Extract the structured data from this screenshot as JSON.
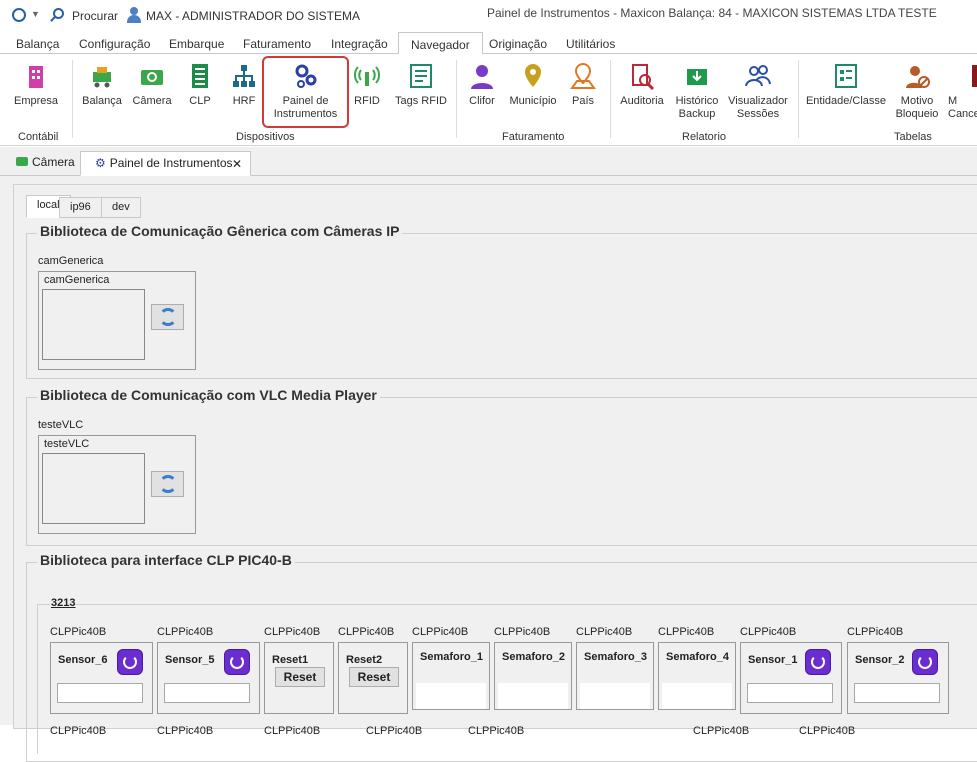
{
  "titlebar": {
    "search_label": "Procurar",
    "user_label": "MAX - ADMINISTRADOR DO SISTEMA",
    "window_title": "Painel de Instrumentos - Maxicon Balança: 84 - MAXICON SISTEMAS LTDA TESTE"
  },
  "ribbon_tabs": [
    "Balança",
    "Configuração",
    "Embarque",
    "Faturamento",
    "Integração",
    "Navegador",
    "Originação",
    "Utilitários"
  ],
  "ribbon": {
    "buttons": [
      {
        "label": "Empresa",
        "icon": "building-icon"
      },
      {
        "label": "Balança",
        "icon": "scale-cart-icon"
      },
      {
        "label": "Câmera",
        "icon": "camera-icon"
      },
      {
        "label": "CLP",
        "icon": "clp-icon"
      },
      {
        "label": "HRF",
        "icon": "network-tree-icon"
      },
      {
        "label": "Painel de Instrumentos",
        "icon": "gears-icon"
      },
      {
        "label": "RFID",
        "icon": "rfid-icon"
      },
      {
        "label": "Tags RFID",
        "icon": "tags-rfid-icon"
      },
      {
        "label": "Clifor",
        "icon": "person-icon"
      },
      {
        "label": "Município",
        "icon": "map-pin-icon"
      },
      {
        "label": "País",
        "icon": "map-marker-icon"
      },
      {
        "label": "Auditoria",
        "icon": "audit-icon"
      },
      {
        "label": "Histórico Backup",
        "icon": "backup-icon"
      },
      {
        "label": "Visualizador Sessões",
        "icon": "users-icon"
      },
      {
        "label": "Entidade/Classe",
        "icon": "entity-icon"
      },
      {
        "label": "Motivo Bloqueio",
        "icon": "block-user-icon"
      },
      {
        "label": "M Cance",
        "icon": "cancel-icon"
      }
    ],
    "groups": [
      "Contábil",
      "Dispositivos",
      "Faturamento",
      "Relatorio",
      "Tabelas"
    ]
  },
  "doc_tabs": {
    "camera": "Câmera",
    "painel": "Painel de Instrumentos",
    "close": "✕"
  },
  "panel_tabs": [
    "local",
    "ip96",
    "dev"
  ],
  "sections": {
    "cam_ip": {
      "title": "Biblioteca de Comunicação Gênerica com Câmeras IP",
      "outer_label": "camGenerica",
      "inner_label": "camGenerica"
    },
    "vlc": {
      "title": "Biblioteca de Comunicação com VLC Media Player",
      "outer_label": "testeVLC",
      "inner_label": "testeVLC"
    },
    "clp": {
      "title": "Biblioteca para interface CLP PIC40-B",
      "subgroup": "3213",
      "cards": [
        {
          "caption": "CLPPic40B",
          "label": "Sensor_6",
          "kind": "sensor"
        },
        {
          "caption": "CLPPic40B",
          "label": "Sensor_5",
          "kind": "sensor"
        },
        {
          "caption": "CLPPic40B",
          "label": "Reset1",
          "kind": "reset",
          "button": "Reset"
        },
        {
          "caption": "CLPPic40B",
          "label": "Reset2",
          "kind": "reset",
          "button": "Reset"
        },
        {
          "caption": "CLPPic40B",
          "label": "Semaforo_1",
          "kind": "semaforo"
        },
        {
          "caption": "CLPPic40B",
          "label": "Semaforo_2",
          "kind": "semaforo"
        },
        {
          "caption": "CLPPic40B",
          "label": "Semaforo_3",
          "kind": "semaforo"
        },
        {
          "caption": "CLPPic40B",
          "label": "Semaforo_4",
          "kind": "semaforo"
        },
        {
          "caption": "CLPPic40B",
          "label": "Sensor_1",
          "kind": "sensor"
        },
        {
          "caption": "CLPPic40B",
          "label": "Sensor_2",
          "kind": "sensor"
        }
      ],
      "row2_caption": "CLPPic40B"
    }
  },
  "colors": {
    "accent": "#6a2dd1",
    "highlight": "#d23a3a",
    "icon_blue": "#2a5fa0"
  }
}
